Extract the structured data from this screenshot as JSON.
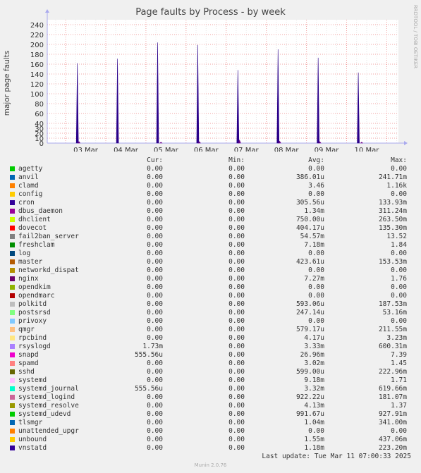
{
  "chart_data": {
    "type": "line",
    "title": "Page faults by Process - by week",
    "ylabel": "major page faults",
    "xlabel": "",
    "x_ticks": [
      "03 Mar",
      "04 Mar",
      "05 Mar",
      "06 Mar",
      "07 Mar",
      "08 Mar",
      "09 Mar",
      "10 Mar"
    ],
    "y_ticks": [
      0,
      10,
      20,
      30,
      40,
      60,
      80,
      100,
      120,
      140,
      160,
      180,
      200,
      220,
      240
    ],
    "ylim": [
      0,
      250
    ],
    "x_range": [
      "2025-03-02T13:00",
      "2025-03-11T07:00"
    ],
    "grid": true,
    "series": [
      {
        "name": "cron",
        "color": "#2a0089",
        "points": [
          [
            "2025-03-03T07:00",
            162
          ],
          [
            "2025-03-04T07:00",
            171
          ],
          [
            "2025-03-05T07:00",
            204
          ],
          [
            "2025-03-06T07:00",
            199
          ],
          [
            "2025-03-07T07:00",
            148
          ],
          [
            "2025-03-08T07:00",
            190
          ],
          [
            "2025-03-09T07:00",
            173
          ],
          [
            "2025-03-10T07:00",
            143
          ]
        ]
      },
      {
        "name": "nginx",
        "color": "#6a008a",
        "points": [
          [
            "2025-03-03T08:00",
            3
          ],
          [
            "2025-03-05T09:00",
            2
          ],
          [
            "2025-03-06T08:00",
            3
          ],
          [
            "2025-03-07T08:00",
            6
          ],
          [
            "2025-03-08T08:00",
            4
          ],
          [
            "2025-03-09T08:00",
            3
          ],
          [
            "2025-03-10T09:00",
            2
          ]
        ]
      }
    ]
  },
  "legend": {
    "headers": {
      "cur": "Cur:",
      "min": "Min:",
      "avg": "Avg:",
      "max": "Max:"
    },
    "rows": [
      {
        "name": "agetty",
        "color": "#00cc00",
        "cur": "0.00",
        "min": "0.00",
        "avg": "0.00",
        "max": "0.00"
      },
      {
        "name": "anvil",
        "color": "#0066b3",
        "cur": "0.00",
        "min": "0.00",
        "avg": "386.01u",
        "max": "241.71m"
      },
      {
        "name": "clamd",
        "color": "#ff8000",
        "cur": "0.00",
        "min": "0.00",
        "avg": "3.46",
        "max": "1.16k"
      },
      {
        "name": "config",
        "color": "#ffcc00",
        "cur": "0.00",
        "min": "0.00",
        "avg": "0.00",
        "max": "0.00"
      },
      {
        "name": "cron",
        "color": "#330099",
        "cur": "0.00",
        "min": "0.00",
        "avg": "305.56u",
        "max": "133.93m"
      },
      {
        "name": "dbus_daemon",
        "color": "#990099",
        "cur": "0.00",
        "min": "0.00",
        "avg": "1.34m",
        "max": "311.24m"
      },
      {
        "name": "dhclient",
        "color": "#ccff00",
        "cur": "0.00",
        "min": "0.00",
        "avg": "750.00u",
        "max": "263.50m"
      },
      {
        "name": "dovecot",
        "color": "#ff0000",
        "cur": "0.00",
        "min": "0.00",
        "avg": "404.17u",
        "max": "135.30m"
      },
      {
        "name": "fail2ban_server",
        "color": "#808080",
        "cur": "0.00",
        "min": "0.00",
        "avg": "54.57m",
        "max": "13.52"
      },
      {
        "name": "freshclam",
        "color": "#008f00",
        "cur": "0.00",
        "min": "0.00",
        "avg": "7.18m",
        "max": "1.84"
      },
      {
        "name": "log",
        "color": "#00487d",
        "cur": "0.00",
        "min": "0.00",
        "avg": "0.00",
        "max": "0.00"
      },
      {
        "name": "master",
        "color": "#b35a00",
        "cur": "0.00",
        "min": "0.00",
        "avg": "423.61u",
        "max": "153.53m"
      },
      {
        "name": "networkd_dispat",
        "color": "#b38f00",
        "cur": "0.00",
        "min": "0.00",
        "avg": "0.00",
        "max": "0.00"
      },
      {
        "name": "nginx",
        "color": "#6b006b",
        "cur": "0.00",
        "min": "0.00",
        "avg": "7.27m",
        "max": "1.76"
      },
      {
        "name": "opendkim",
        "color": "#8fb300",
        "cur": "0.00",
        "min": "0.00",
        "avg": "0.00",
        "max": "0.00"
      },
      {
        "name": "opendmarc",
        "color": "#b30000",
        "cur": "0.00",
        "min": "0.00",
        "avg": "0.00",
        "max": "0.00"
      },
      {
        "name": "polkitd",
        "color": "#bebebe",
        "cur": "0.00",
        "min": "0.00",
        "avg": "593.06u",
        "max": "187.53m"
      },
      {
        "name": "postsrsd",
        "color": "#80ff80",
        "cur": "0.00",
        "min": "0.00",
        "avg": "247.14u",
        "max": "53.16m"
      },
      {
        "name": "privoxy",
        "color": "#80c9ff",
        "cur": "0.00",
        "min": "0.00",
        "avg": "0.00",
        "max": "0.00"
      },
      {
        "name": "qmgr",
        "color": "#ffc080",
        "cur": "0.00",
        "min": "0.00",
        "avg": "579.17u",
        "max": "211.55m"
      },
      {
        "name": "rpcbind",
        "color": "#ffe680",
        "cur": "0.00",
        "min": "0.00",
        "avg": "4.17u",
        "max": "3.23m"
      },
      {
        "name": "rsyslogd",
        "color": "#aa80ff",
        "cur": "1.73m",
        "min": "0.00",
        "avg": "3.33m",
        "max": "600.31m"
      },
      {
        "name": "snapd",
        "color": "#ee00cc",
        "cur": "555.56u",
        "min": "0.00",
        "avg": "26.96m",
        "max": "7.39"
      },
      {
        "name": "spamd",
        "color": "#ff8080",
        "cur": "0.00",
        "min": "0.00",
        "avg": "3.02m",
        "max": "1.45"
      },
      {
        "name": "sshd",
        "color": "#666600",
        "cur": "0.00",
        "min": "0.00",
        "avg": "599.00u",
        "max": "222.96m"
      },
      {
        "name": "systemd",
        "color": "#ffbfff",
        "cur": "0.00",
        "min": "0.00",
        "avg": "9.18m",
        "max": "1.71"
      },
      {
        "name": "systemd_journal",
        "color": "#00ffcc",
        "cur": "555.56u",
        "min": "0.00",
        "avg": "3.32m",
        "max": "619.66m"
      },
      {
        "name": "systemd_logind",
        "color": "#cc6699",
        "cur": "0.00",
        "min": "0.00",
        "avg": "922.22u",
        "max": "181.07m"
      },
      {
        "name": "systemd_resolve",
        "color": "#999900",
        "cur": "0.00",
        "min": "0.00",
        "avg": "4.13m",
        "max": "1.37"
      },
      {
        "name": "systemd_udevd",
        "color": "#00cc00",
        "cur": "0.00",
        "min": "0.00",
        "avg": "991.67u",
        "max": "927.91m"
      },
      {
        "name": "tlsmgr",
        "color": "#0066b3",
        "cur": "0.00",
        "min": "0.00",
        "avg": "1.04m",
        "max": "341.00m"
      },
      {
        "name": "unattended_upgr",
        "color": "#ff8000",
        "cur": "0.00",
        "min": "0.00",
        "avg": "0.00",
        "max": "0.00"
      },
      {
        "name": "unbound",
        "color": "#ffcc00",
        "cur": "0.00",
        "min": "0.00",
        "avg": "1.55m",
        "max": "437.06m"
      },
      {
        "name": "vnstatd",
        "color": "#330099",
        "cur": "0.00",
        "min": "0.00",
        "avg": "1.18m",
        "max": "223.20m"
      }
    ]
  },
  "last_update": "Last update: Tue Mar 11 07:00:33 2025",
  "watermark": "RRDTOOL / TOBI OETIKER",
  "footer": "Munin 2.0.76"
}
